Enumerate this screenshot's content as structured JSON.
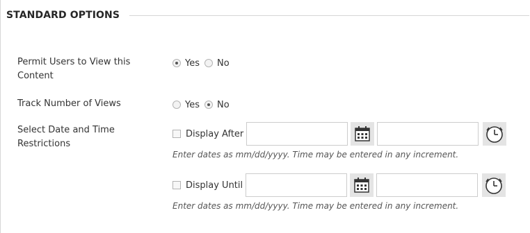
{
  "section": {
    "title": "STANDARD OPTIONS"
  },
  "permit_view": {
    "label": "Permit Users to View this Content",
    "options": [
      {
        "label": "Yes",
        "checked": true
      },
      {
        "label": "No",
        "checked": false
      }
    ]
  },
  "track_views": {
    "label": "Track Number of Views",
    "options": [
      {
        "label": "Yes",
        "checked": false
      },
      {
        "label": "No",
        "checked": true
      }
    ]
  },
  "date_restrictions": {
    "label": "Select Date and Time Restrictions",
    "display_after": {
      "label": "Display After",
      "date_value": "",
      "time_value": "",
      "hint": "Enter dates as mm/dd/yyyy. Time may be entered in any increment."
    },
    "display_until": {
      "label": "Display Until",
      "date_value": "",
      "time_value": "",
      "hint": "Enter dates as mm/dd/yyyy. Time may be entered in any increment."
    }
  },
  "icons": {
    "calendar": "calendar-icon",
    "clock": "clock-icon"
  }
}
